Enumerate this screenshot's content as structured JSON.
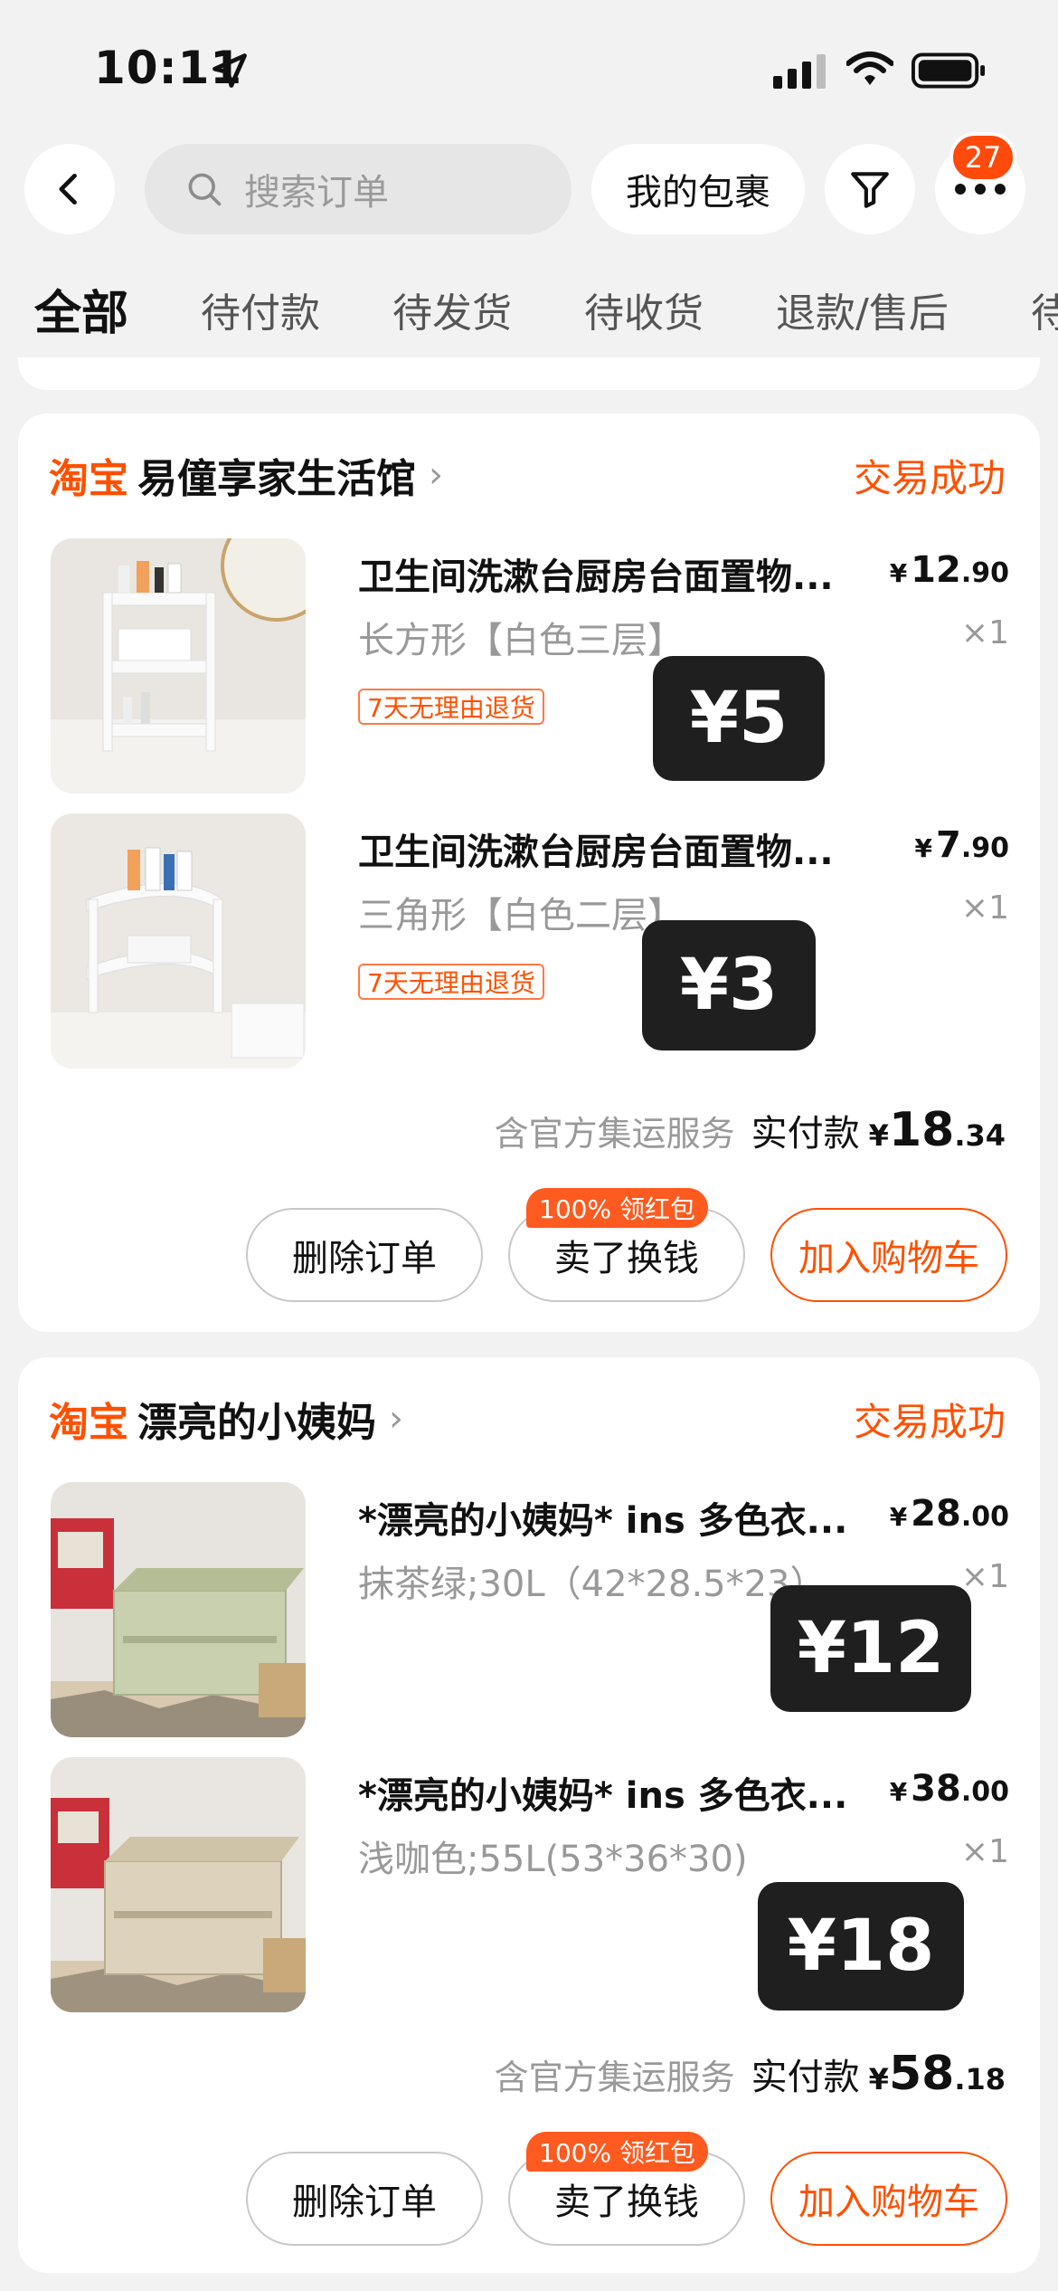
{
  "status_bar": {
    "time": "10:11"
  },
  "top_bar": {
    "search_placeholder": "搜索订单",
    "my_packages": "我的包裹",
    "more_badge": "27"
  },
  "tabs": [
    "全部",
    "待付款",
    "待发货",
    "待收货",
    "退款/售后",
    "待"
  ],
  "orders": [
    {
      "logo": "淘宝",
      "shop": "易僮享家生活馆",
      "status": "交易成功",
      "items": [
        {
          "title": "卫生间洗漱台厨房台面置物...",
          "price_int": "12",
          "price_dec": ".90",
          "spec": "长方形【白色三层】",
          "qty": "×1",
          "tag": "7天无理由退货",
          "overlay": "¥5"
        },
        {
          "title": "卫生间洗漱台厨房台面置物...",
          "price_int": "7",
          "price_dec": ".90",
          "spec": "三角形【白色二层】",
          "qty": "×1",
          "tag": "7天无理由退货",
          "overlay": "¥3"
        }
      ],
      "service": "含官方集运服务",
      "paid_label": "实付款",
      "total_int": "18",
      "total_dec": ".34",
      "buttons": {
        "delete": "删除订单",
        "sell": "卖了换钱",
        "cart": "加入购物车",
        "promo": "100% 领红包"
      }
    },
    {
      "logo": "淘宝",
      "shop": "漂亮的小姨妈",
      "status": "交易成功",
      "items": [
        {
          "title": "*漂亮的小姨妈* ins 多色衣...",
          "price_int": "28",
          "price_dec": ".00",
          "spec": "抹茶绿;30L（42*28.5*23）",
          "qty": "×1",
          "overlay": "¥12"
        },
        {
          "title": "*漂亮的小姨妈* ins 多色衣...",
          "price_int": "38",
          "price_dec": ".00",
          "spec": "浅咖色;55L(53*36*30)",
          "qty": "×1",
          "overlay": "¥18"
        }
      ],
      "service": "含官方集运服务",
      "paid_label": "实付款",
      "total_int": "58",
      "total_dec": ".18",
      "buttons": {
        "delete": "删除订单",
        "sell": "卖了换钱",
        "cart": "加入购物车",
        "promo": "100% 领红包"
      }
    }
  ],
  "currency": "¥",
  "colors": {
    "accent": "#ff5000",
    "badge": "#ff4a0c",
    "background": "#f2f2f2"
  }
}
